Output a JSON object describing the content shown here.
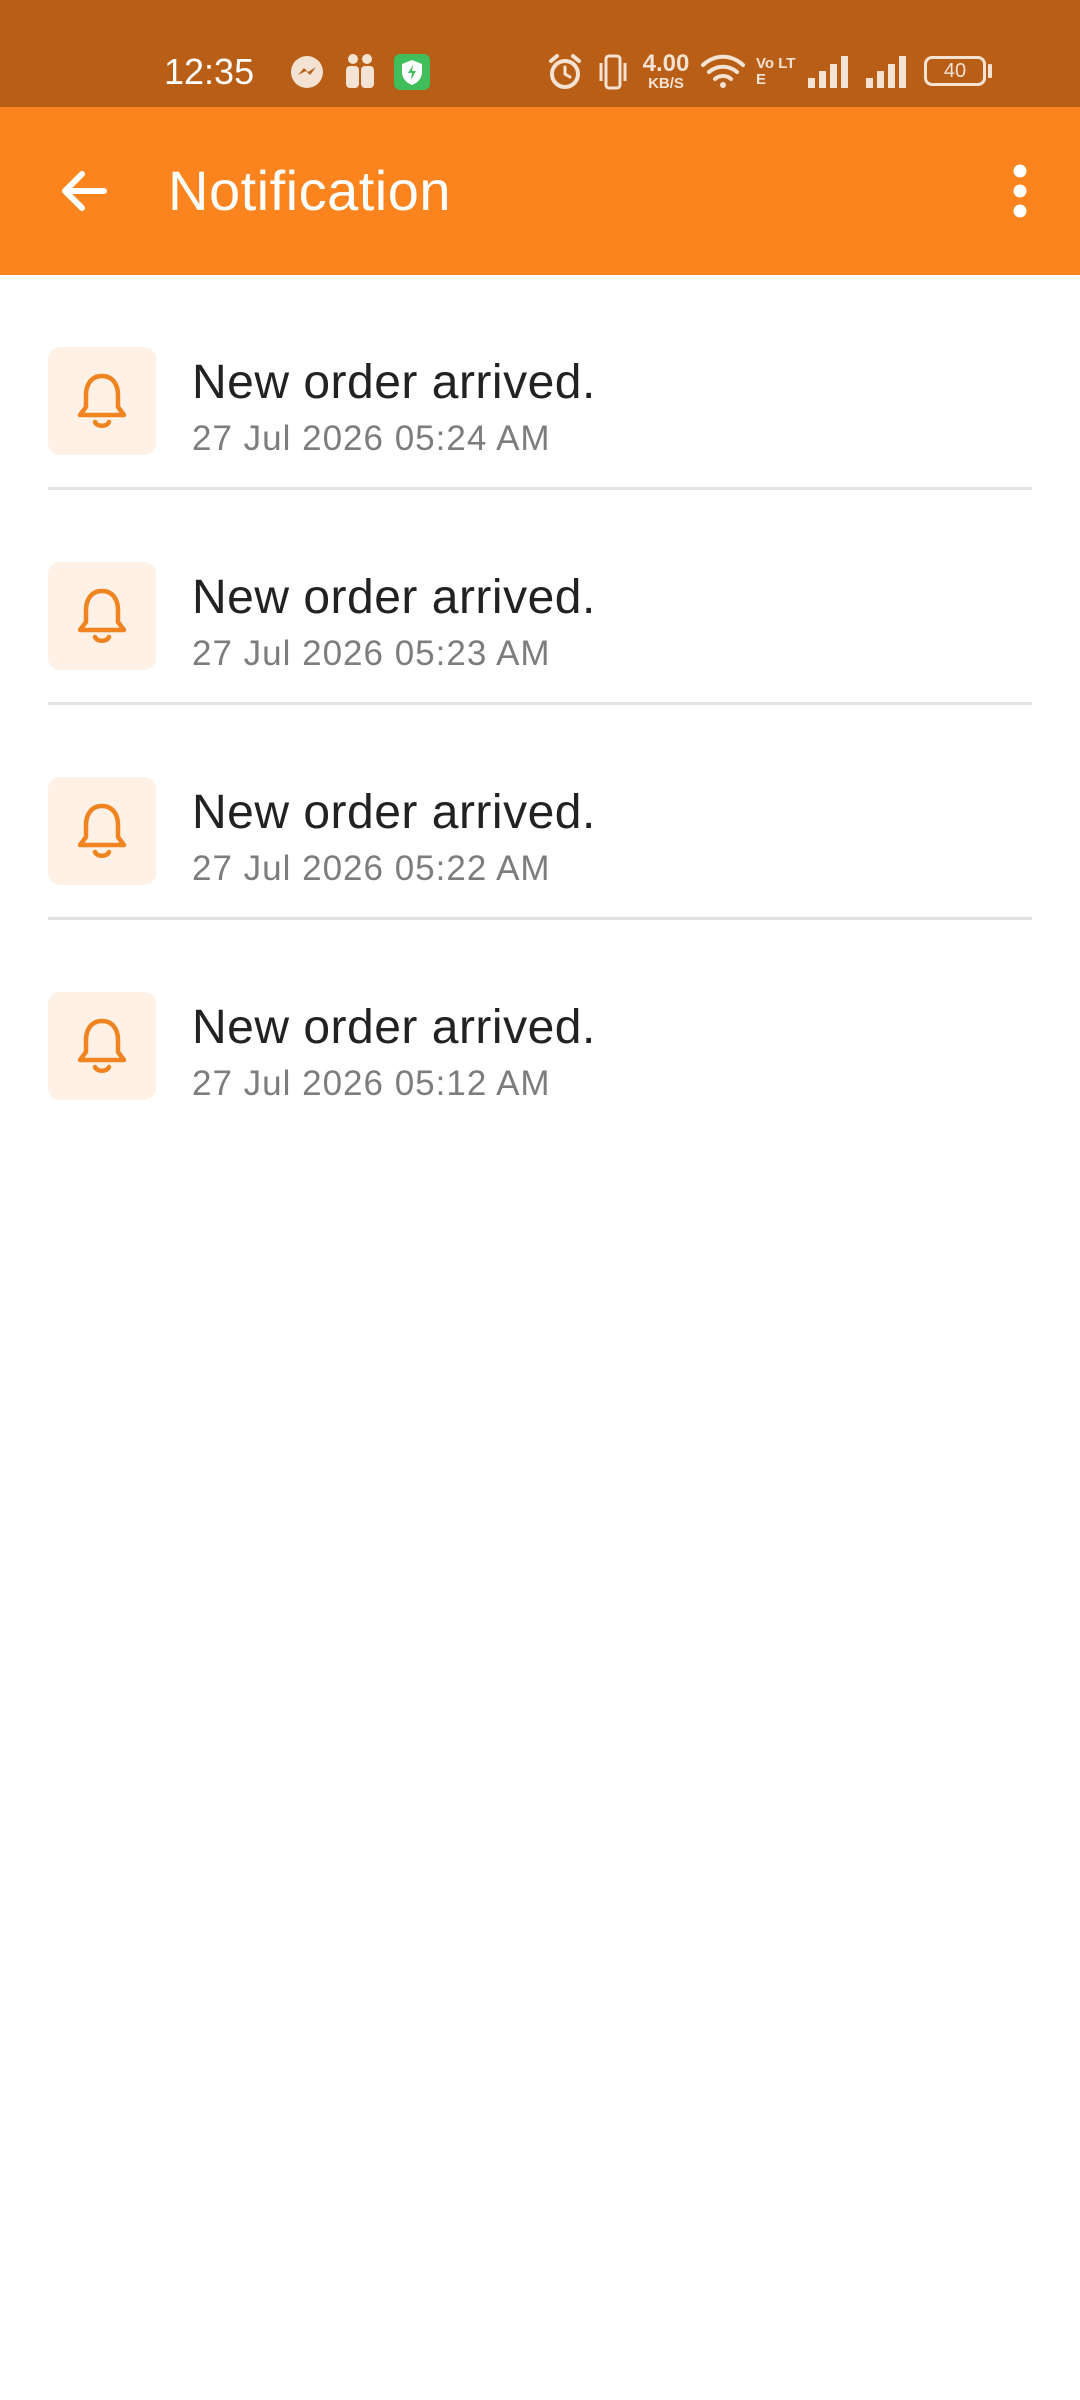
{
  "status_bar": {
    "time": "12:35",
    "network_speed_value": "4.00",
    "network_speed_unit": "KB/S",
    "volte_label": "Vo LTE",
    "battery_level": "40",
    "icons": [
      "messenger-icon",
      "teams-icon",
      "shield-app-icon",
      "alarm-icon",
      "vibrate-icon",
      "wifi-icon",
      "volte-icon",
      "signal-icon",
      "signal-icon",
      "battery-icon"
    ]
  },
  "app_bar": {
    "title": "Notification",
    "back_icon": "arrow-left-icon",
    "menu_icon": "more-vertical-icon"
  },
  "notifications": [
    {
      "title": "New order arrived.",
      "time": "27 Jul 2026 05:24 AM"
    },
    {
      "title": "New order arrived.",
      "time": "27 Jul 2026 05:23 AM"
    },
    {
      "title": "New order arrived.",
      "time": "27 Jul 2026 05:22 AM"
    },
    {
      "title": "New order arrived.",
      "time": "27 Jul 2026 05:12 AM"
    }
  ],
  "colors": {
    "status_bar": "#B95E16",
    "app_bar": "#FC841F",
    "accent": "#F08420",
    "icon_bg": "#FFF1E6",
    "divider": "#E2E2E2",
    "title_text": "#222222",
    "time_text": "#7D7D7D"
  }
}
